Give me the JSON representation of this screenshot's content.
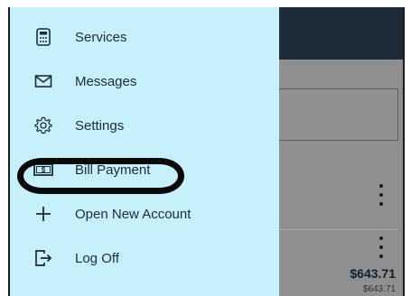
{
  "menu": {
    "items": [
      {
        "label": "Services",
        "icon": "calculator-icon"
      },
      {
        "label": "Messages",
        "icon": "envelope-icon"
      },
      {
        "label": "Settings",
        "icon": "gear-icon"
      },
      {
        "label": "Bill Payment",
        "icon": "cash-icon"
      },
      {
        "label": "Open New Account",
        "icon": "plus-icon"
      },
      {
        "label": "Log Off",
        "icon": "logout-icon"
      }
    ],
    "highlighted_item": "Bill Payment"
  },
  "background": {
    "amount": "$643.71",
    "amount_sub": "$643.71"
  },
  "colors": {
    "drawer_bg": "#c6f1fb",
    "header_bg": "#1e2c3a",
    "overlay_bg": "#8f8f8f",
    "highlight_ring": "#0a0a0a"
  }
}
